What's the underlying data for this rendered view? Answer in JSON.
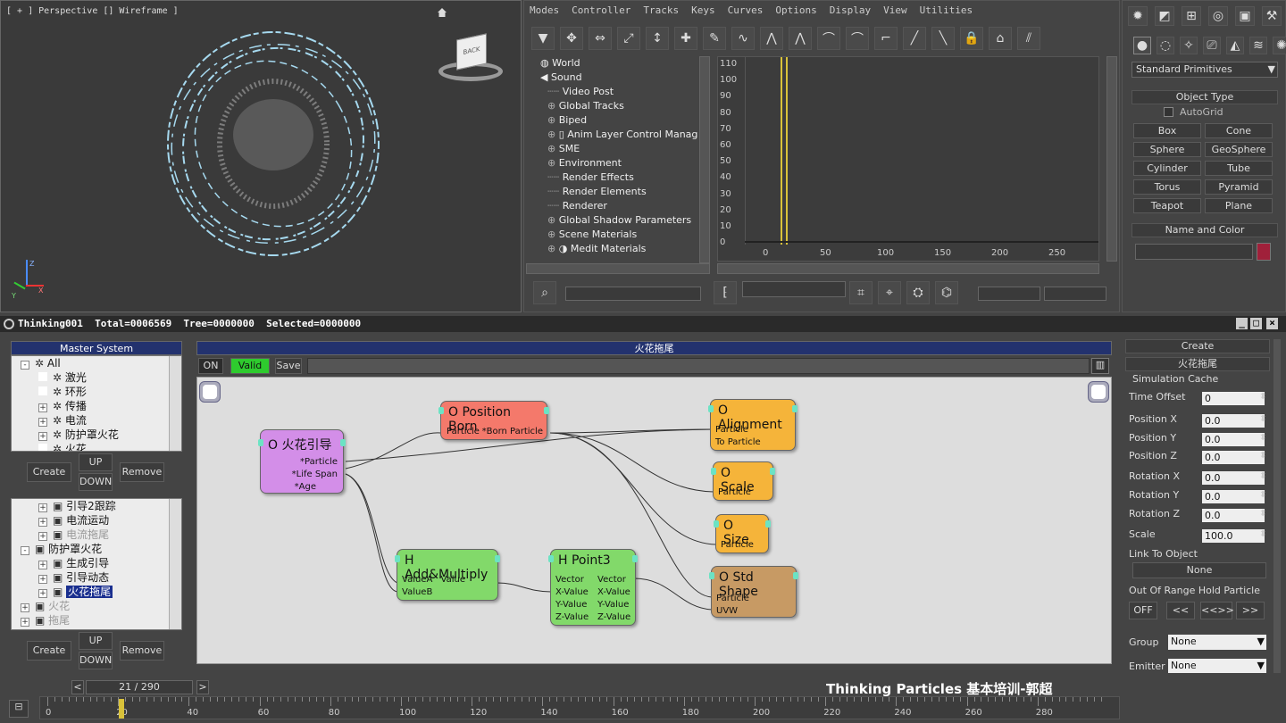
{
  "viewport": {
    "label": "[ + ] Perspective [] Wireframe ]",
    "viewcube_label": "BACK",
    "axis_x": "X",
    "axis_y": "Y",
    "axis_z": "Z"
  },
  "trackview": {
    "menu": [
      "Modes",
      "Controller",
      "Tracks",
      "Keys",
      "Curves",
      "Options",
      "Display",
      "View",
      "Utilities"
    ],
    "tree": [
      {
        "label": "World",
        "expander": false,
        "icon": "globe-icon"
      },
      {
        "label": "Sound",
        "expander": false,
        "icon": "speaker-icon"
      },
      {
        "label": "Video Post",
        "expander": false,
        "icon": ""
      },
      {
        "label": "Global Tracks",
        "expander": true,
        "icon": ""
      },
      {
        "label": "Biped",
        "expander": true,
        "icon": ""
      },
      {
        "label": "Anim Layer Control Manager",
        "expander": true,
        "icon": "layer-icon"
      },
      {
        "label": "SME",
        "expander": true,
        "icon": ""
      },
      {
        "label": "Environment",
        "expander": true,
        "icon": ""
      },
      {
        "label": "Render Effects",
        "expander": false,
        "icon": ""
      },
      {
        "label": "Render Elements",
        "expander": false,
        "icon": ""
      },
      {
        "label": "Renderer",
        "expander": false,
        "icon": ""
      },
      {
        "label": "Global Shadow Parameters",
        "expander": true,
        "icon": ""
      },
      {
        "label": "Scene Materials",
        "expander": true,
        "icon": ""
      },
      {
        "label": "Medit Materials",
        "expander": true,
        "icon": "material-icon"
      }
    ],
    "y_ticks": [
      "110",
      "100",
      "90",
      "80",
      "70",
      "60",
      "50",
      "40",
      "30",
      "20",
      "10",
      "0"
    ],
    "x_ticks": [
      "0",
      "50",
      "100",
      "150",
      "200",
      "250"
    ]
  },
  "command_panel": {
    "dropdown": "Standard Primitives",
    "object_type_header": "Object Type",
    "autogrid": "AutoGrid",
    "buttons": [
      "Box",
      "Cone",
      "Sphere",
      "GeoSphere",
      "Cylinder",
      "Tube",
      "Torus",
      "Pyramid",
      "Teapot",
      "Plane"
    ],
    "name_color_header": "Name and Color",
    "color": "#a0203a"
  },
  "tp_title": "Thinking001  Total=0006569  Tree=0000000  Selected=0000000",
  "master": {
    "header": "Master System",
    "items": [
      {
        "label": "All",
        "indent": 0,
        "expander": "-"
      },
      {
        "label": "激光",
        "indent": 1,
        "expander": ""
      },
      {
        "label": "环形",
        "indent": 1,
        "expander": ""
      },
      {
        "label": "传播",
        "indent": 1,
        "expander": "+"
      },
      {
        "label": "电流",
        "indent": 1,
        "expander": "+"
      },
      {
        "label": "防护罩火花",
        "indent": 1,
        "expander": "+"
      },
      {
        "label": "火花",
        "indent": 1,
        "expander": ""
      }
    ],
    "create": "Create",
    "up": "UP",
    "down": "DOWN",
    "remove": "Remove"
  },
  "dyn": {
    "items": [
      {
        "label": "引导2跟踪",
        "indent": 1,
        "expander": "+",
        "greyed": false,
        "selected": false
      },
      {
        "label": "电流运动",
        "indent": 1,
        "expander": "+",
        "greyed": false,
        "selected": false
      },
      {
        "label": "电流拖尾",
        "indent": 1,
        "expander": "+",
        "greyed": true,
        "selected": false
      },
      {
        "label": "防护罩火花",
        "indent": 0,
        "expander": "-",
        "greyed": false,
        "selected": false
      },
      {
        "label": "生成引导",
        "indent": 1,
        "expander": "+",
        "greyed": false,
        "selected": false
      },
      {
        "label": "引导动态",
        "indent": 1,
        "expander": "+",
        "greyed": false,
        "selected": false
      },
      {
        "label": "火花拖尾",
        "indent": 1,
        "expander": "+",
        "greyed": false,
        "selected": true
      },
      {
        "label": "火花",
        "indent": 0,
        "expander": "+",
        "greyed": true,
        "selected": false
      },
      {
        "label": "拖尾",
        "indent": 0,
        "expander": "+",
        "greyed": true,
        "selected": false
      }
    ],
    "create": "Create",
    "up": "UP",
    "down": "DOWN",
    "remove": "Remove"
  },
  "graph": {
    "header": "火花拖尾",
    "on": "ON",
    "valid": "Valid",
    "save": "Save",
    "nodes": {
      "guide": {
        "title": "O 火花引导",
        "ports": [
          "*Particle",
          "*Life Span",
          "*Age"
        ]
      },
      "posborn": {
        "title": "O Position Born",
        "left": "Particle",
        "right": "*Born Particle"
      },
      "align": {
        "title": "O Alignment",
        "ports": [
          "Particle",
          "To Particle"
        ]
      },
      "scale": {
        "title": "O Scale",
        "ports": [
          "Particle"
        ]
      },
      "size": {
        "title": "O Size",
        "ports": [
          "Particle"
        ]
      },
      "stdshape": {
        "title": "O Std Shape",
        "ports": [
          "Particle",
          "UVW"
        ]
      },
      "addmul": {
        "title": "H Add&Multiply",
        "left": [
          "ValueA",
          "ValueB"
        ],
        "right": "Value"
      },
      "point3": {
        "title": "H Point3",
        "left": [
          "Vector",
          "X-Value",
          "Y-Value",
          "Z-Value"
        ],
        "right": [
          "Vector",
          "X-Value",
          "Y-Value",
          "Z-Value"
        ]
      }
    }
  },
  "props": {
    "create": "Create",
    "title": "火花拖尾",
    "section": "Simulation Cache",
    "fields": [
      {
        "label": "Time Offset",
        "value": "0"
      },
      {
        "label": "Position X",
        "value": "0.0"
      },
      {
        "label": "Position Y",
        "value": "0.0"
      },
      {
        "label": "Position Z",
        "value": "0.0"
      },
      {
        "label": "Rotation X",
        "value": "0.0"
      },
      {
        "label": "Rotation Y",
        "value": "0.0"
      },
      {
        "label": "Rotation Z",
        "value": "0.0"
      },
      {
        "label": "Scale",
        "value": "100.0"
      }
    ],
    "link_label": "Link To Object",
    "link_value": "None",
    "range_label": "Out Of Range Hold Particle",
    "range_buttons": [
      "OFF",
      "<<",
      "<<>>",
      ">>"
    ],
    "group_label": "Group",
    "group_value": "None",
    "emitter_label": "Emitter",
    "emitter_value": "None"
  },
  "timeline": {
    "frame": "21 / 290",
    "prev": "<",
    "next": ">",
    "watermark": "Thinking Particles 基本培训-郭超",
    "ticks": [
      "0",
      "20",
      "40",
      "60",
      "80",
      "100",
      "120",
      "140",
      "160",
      "180",
      "200",
      "220",
      "240",
      "260",
      "280"
    ]
  }
}
